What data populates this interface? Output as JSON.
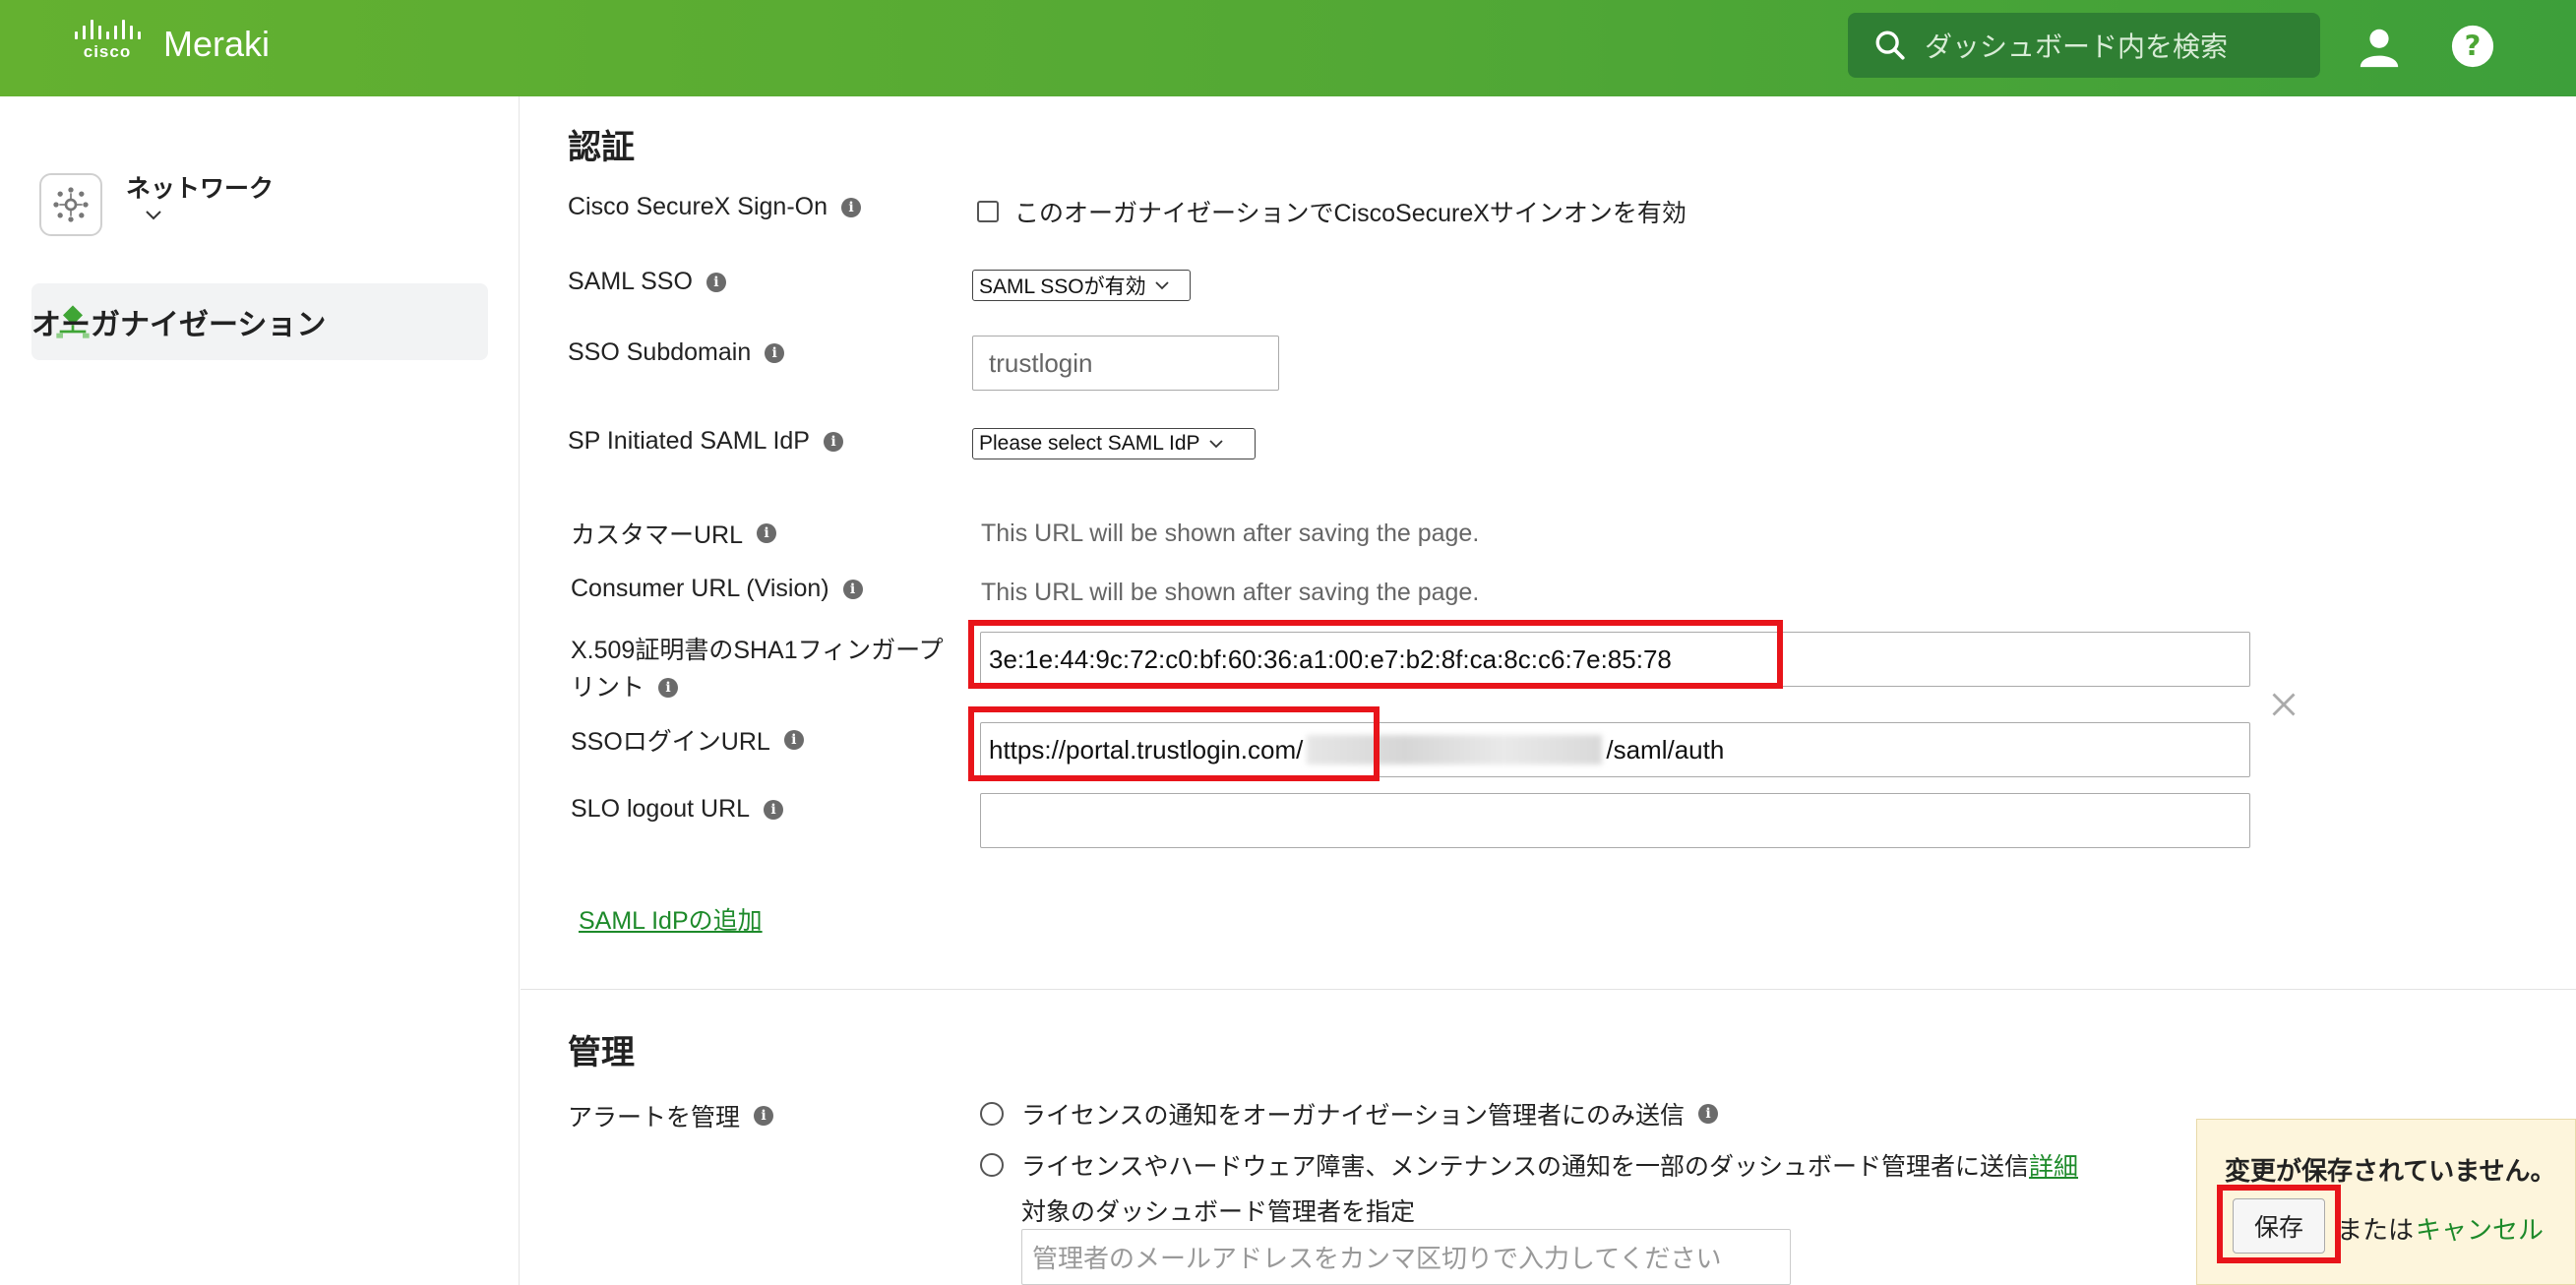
{
  "header": {
    "brand_cisco": "cisco",
    "brand_product": "Meraki",
    "search_placeholder": "ダッシュボード内を検索"
  },
  "sidebar": {
    "network_label": "ネットワーク",
    "org_label": "オーガナイゼーション"
  },
  "auth": {
    "title": "認証",
    "securex_label": "Cisco SecureX Sign-On",
    "securex_checkbox_text": "このオーガナイゼーションでCiscoSecureXサインオンを有効",
    "saml_sso_label": "SAML SSO",
    "saml_sso_value": "SAML SSOが有効",
    "sso_subdomain_label": "SSO Subdomain",
    "sso_subdomain_value": "trustlogin",
    "sp_initiated_label": "SP Initiated SAML IdP",
    "sp_initiated_value": "Please select SAML IdP",
    "customer_url_label": "カスタマーURL",
    "customer_url_value": "This URL will be shown after saving the page.",
    "consumer_url_label": "Consumer URL (Vision)",
    "consumer_url_value": "This URL will be shown after saving the page.",
    "x509_label_line1": "X.509証明書のSHA1フィンガープ",
    "x509_label_line2": "リント",
    "x509_value": "3e:1e:44:9c:72:c0:bf:60:36:a1:00:e7:b2:8f:ca:8c:c6:7e:85:78",
    "sso_login_label": "SSOログインURL",
    "sso_login_prefix": "https://portal.trustlogin.com/",
    "sso_login_suffix": "/saml/auth",
    "slo_label": "SLO logout URL",
    "slo_value": "",
    "add_idp_link": "SAML IdPの追加"
  },
  "management": {
    "title": "管理",
    "alert_label": "アラートを管理",
    "radio1": "ライセンスの通知をオーガナイゼーション管理者にのみ送信",
    "radio2": "ライセンスやハードウェア障害、メンテナンスの通知を一部のダッシュボード管理者に送信",
    "radio2_link": "詳細",
    "target_label": "対象のダッシュボード管理者を指定",
    "email_placeholder": "管理者のメールアドレスをカンマ区切りで入力してください"
  },
  "unsaved": {
    "message": "変更が保存されていません。",
    "save_label": "保存",
    "or_label": "または",
    "cancel_label": "キャンセル"
  },
  "colors": {
    "header_green": "#52a835",
    "link_green": "#1d8a2a",
    "highlight_red": "#e8141a",
    "unsaved_bg": "#fdf5dc"
  }
}
